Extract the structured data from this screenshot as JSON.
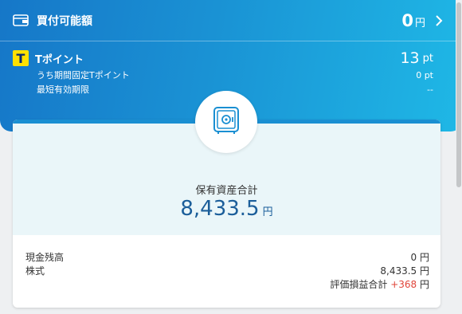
{
  "buy_power": {
    "label": "買付可能額",
    "value": "0",
    "unit": "円"
  },
  "tpoint": {
    "label": "Tポイント",
    "value": "13",
    "unit": "pt",
    "fixed_label": "うち期間固定Tポイント",
    "fixed_value": "0 pt",
    "expiry_label": "最短有効期限",
    "expiry_value": "--"
  },
  "assets": {
    "label": "保有資産合計",
    "value": "8,433.5",
    "unit": "円",
    "cash_label": "現金残高",
    "cash_value": "0 円",
    "stock_label": "株式",
    "stock_value": "8,433.5 円",
    "pnl_label": "評価損益合計",
    "pnl_value": "+368",
    "pnl_unit": "円"
  },
  "icons": {
    "wallet": "wallet-icon",
    "chevron": "chevron-right-icon",
    "safe": "safe-icon",
    "tlogo": "t-point-logo"
  },
  "colors": {
    "header_start": "#1677c8",
    "header_end": "#1fb8e6",
    "accent": "#1b5e9a",
    "positive": "#e0453a",
    "tpoint_yellow": "#ffe100"
  }
}
